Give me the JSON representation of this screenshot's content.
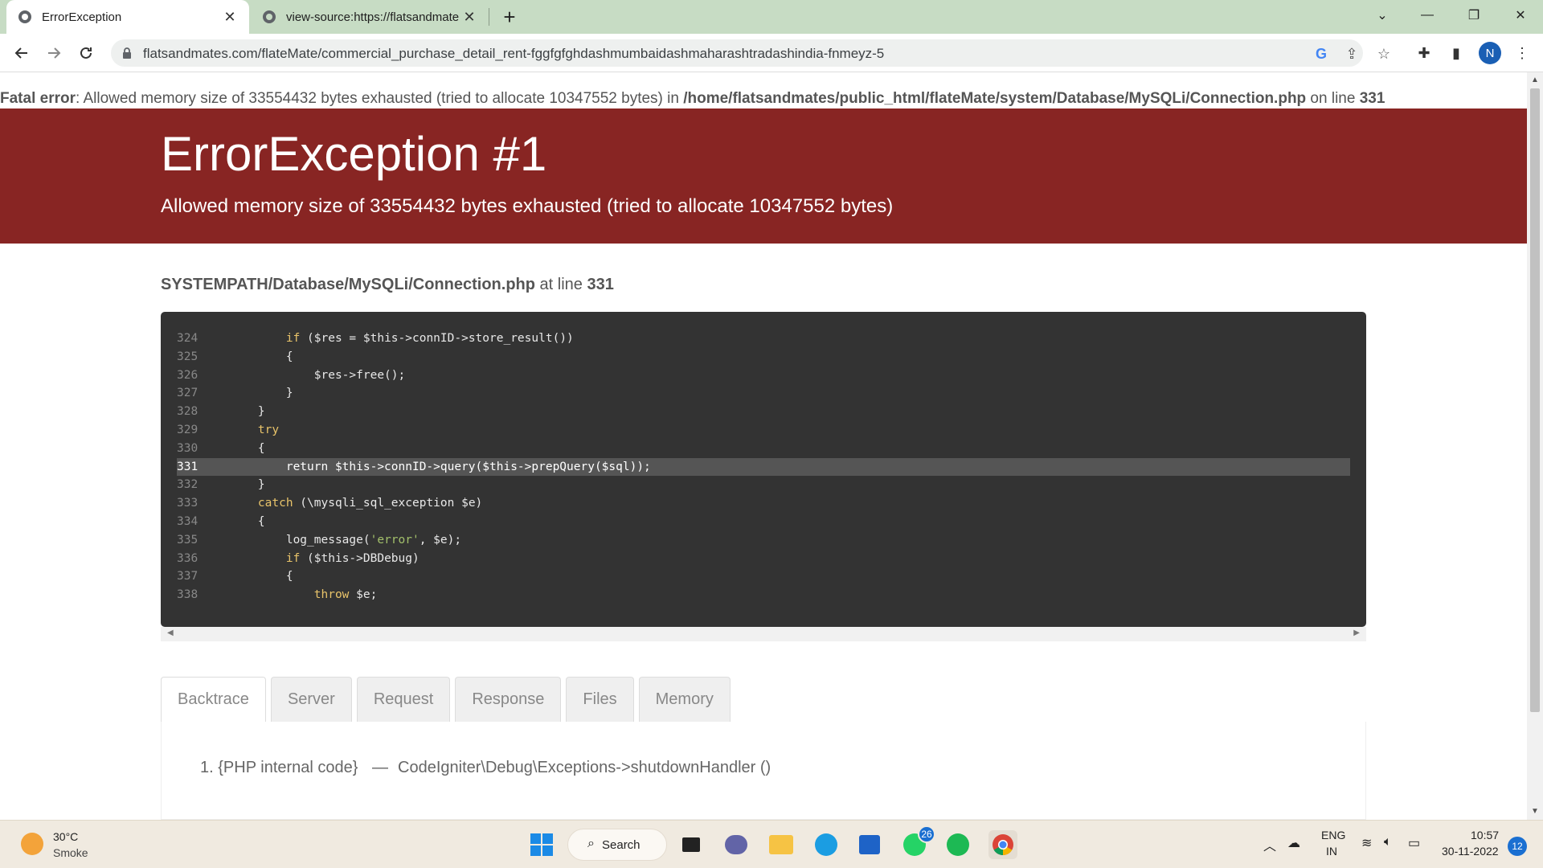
{
  "browser": {
    "tabs": [
      {
        "title": "ErrorException",
        "active": true
      },
      {
        "title": "view-source:https://flatsandmate",
        "active": false
      }
    ],
    "url": "flatsandmates.com/flateMate/commercial_purchase_detail_rent-fggfgfghdashmumbaidashmaharashtradashindia-fnmeyz-5",
    "profile_initial": "N"
  },
  "page": {
    "fatal_label": "Fatal error",
    "fatal_message": ": Allowed memory size of 33554432 bytes exhausted (tried to allocate 10347552 bytes) in ",
    "fatal_path": "/home/flatsandmates/public_html/flateMate/system/Database/MySQLi/Connection.php",
    "fatal_on_line": " on line ",
    "fatal_line": "331",
    "title": "ErrorException #1",
    "message": "Allowed memory size of 33554432 bytes exhausted (tried to allocate 10347552 bytes)",
    "source_path": "SYSTEMPATH/Database/MySQLi/Connection.php",
    "source_at_line": " at line ",
    "source_line": "331",
    "code_lines": [
      {
        "num": "324",
        "code": "        if ($res = $this->connID->store_result())"
      },
      {
        "num": "325",
        "code": "        {"
      },
      {
        "num": "326",
        "code": "            $res->free();"
      },
      {
        "num": "327",
        "code": "        }"
      },
      {
        "num": "328",
        "code": "    }"
      },
      {
        "num": "329",
        "code": "    try"
      },
      {
        "num": "330",
        "code": "    {"
      },
      {
        "num": "331",
        "code": "        return $this->connID->query($this->prepQuery($sql));",
        "highlight": true
      },
      {
        "num": "332",
        "code": "    }"
      },
      {
        "num": "333",
        "code": "    catch (\\mysqli_sql_exception $e)"
      },
      {
        "num": "334",
        "code": "    {"
      },
      {
        "num": "335",
        "code": "        log_message('error', $e);"
      },
      {
        "num": "336",
        "code": "        if ($this->DBDebug)"
      },
      {
        "num": "337",
        "code": "        {"
      },
      {
        "num": "338",
        "code": "            throw $e;"
      }
    ],
    "tabs": [
      "Backtrace",
      "Server",
      "Request",
      "Response",
      "Files",
      "Memory"
    ],
    "active_tab": "Backtrace",
    "backtrace": {
      "index": "1.",
      "location": "{PHP internal code}",
      "separator": "—",
      "call": "CodeIgniter\\Debug\\Exceptions->shutdownHandler ()"
    }
  },
  "taskbar": {
    "weather_temp": "30°C",
    "weather_desc": "Smoke",
    "search_label": "Search",
    "whatsapp_badge": "26",
    "lang_top": "ENG",
    "lang_bottom": "IN",
    "time": "10:57",
    "date": "30-11-2022",
    "notifications": "12"
  }
}
